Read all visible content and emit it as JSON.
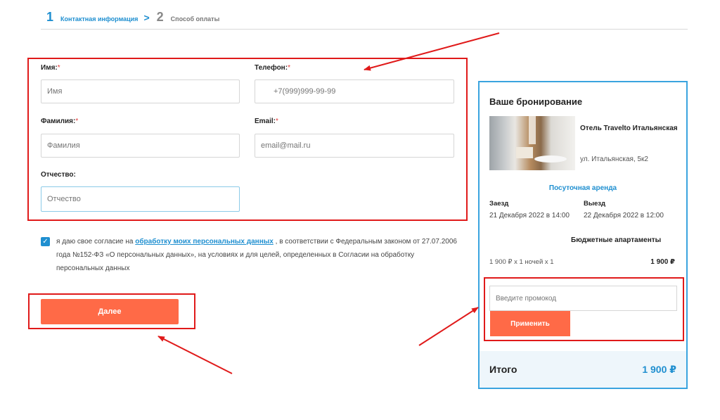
{
  "steps": [
    {
      "number": "1",
      "label": "Контактная информация"
    },
    {
      "number": "2",
      "label": "Способ оплаты"
    }
  ],
  "step_separator": ">",
  "form": {
    "first_name": {
      "label": "Имя:",
      "required_mark": "*",
      "placeholder": "Имя"
    },
    "phone": {
      "label": "Телефон:",
      "required_mark": "*",
      "placeholder": "+7(999)999-99-99"
    },
    "last_name": {
      "label": "Фамилия:",
      "required_mark": "*",
      "placeholder": "Фамилия"
    },
    "email": {
      "label": "Email:",
      "required_mark": "*",
      "placeholder": "email@mail.ru"
    },
    "middle_name": {
      "label": "Отчество:",
      "placeholder": "Отчество"
    }
  },
  "consent": {
    "checked": true,
    "text_before": "я даю свое согласие на",
    "link_text": "обработку моих персональных данных",
    "text_after": ", в соответствии с Федеральным законом от 27.07.2006 года №152-ФЗ «О персональных данных», на условиях и для целей, определенных в Согласии на обработку персональных данных"
  },
  "next_button": "Далее",
  "booking": {
    "title": "Ваше бронирование",
    "hotel_name": "Отель Travelto Итальянская",
    "address": "ул. Итальянская, 5к2",
    "rent_type": "Посуточная аренда",
    "checkin_label": "Заезд",
    "checkin_value": "21 Декабря 2022 в 14:00",
    "checkout_label": "Выезд",
    "checkout_value": "22 Декабря 2022 в 12:00",
    "room_name": "Бюджетные апартаменты",
    "price_calc": "1 900 ₽ x 1 ночей x 1",
    "price_value": "1 900 ₽",
    "promo_placeholder": "Введите промокод",
    "apply_button": "Применить",
    "total_label": "Итого",
    "total_value": "1 900 ₽"
  },
  "colors": {
    "accent_blue": "#1f8fd0",
    "button_orange": "#ff6a47",
    "annotation_red": "#e01a1a"
  }
}
